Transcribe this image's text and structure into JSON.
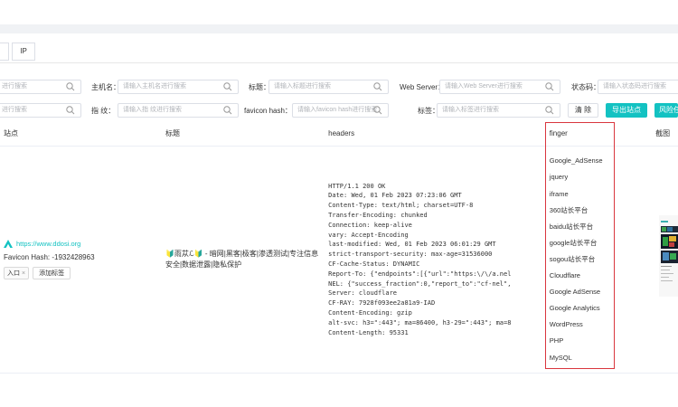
{
  "tabs": {
    "ip_label": "IP"
  },
  "filters": {
    "row1": [
      {
        "label": "",
        "placeholder": "进行搜索"
      },
      {
        "label": "主机名：",
        "placeholder": "请输入主机名进行搜索"
      },
      {
        "label": "标题：",
        "placeholder": "请输入标题进行搜索"
      },
      {
        "label": "Web Server：",
        "placeholder": "请输入Web Server进行搜索"
      },
      {
        "label": "状态码：",
        "placeholder": "请输入状态码进行搜索"
      }
    ],
    "row2": [
      {
        "label": "",
        "placeholder": "进行搜索"
      },
      {
        "label": "指 纹：",
        "placeholder": "请输入指 纹进行搜索"
      },
      {
        "label": "favicon hash：",
        "placeholder": "请输入favicon hash进行搜索"
      },
      {
        "label": "标签：",
        "placeholder": "请输入标签进行搜索"
      }
    ],
    "clear_label": "清 除",
    "export_label": "导出站点",
    "risk_label": "风险任"
  },
  "table": {
    "columns": {
      "site": "站点",
      "title": "标题",
      "headers": "headers",
      "finger": "finger",
      "screenshot": "截图"
    },
    "row": {
      "site_url": "https://www.ddosi.org",
      "favicon_hash": "Favicon Hash: -1932428963",
      "tag": "入口",
      "tag_remove": "×",
      "add_tag_label": "添加标签",
      "title": "🔰雨苁ℒ🔰 - 暗网|黑客|极客|渗透测试|专注信息安全|数据泄露|隐私保护",
      "headers": [
        "HTTP/1.1 200 OK",
        "Date: Wed, 01 Feb 2023 07:23:06 GMT",
        "Content-Type: text/html; charset=UTF-8",
        "Transfer-Encoding: chunked",
        "Connection: keep-alive",
        "vary: Accept-Encoding",
        "last-modified: Wed, 01 Feb 2023 06:01:29 GMT",
        "strict-transport-security: max-age=31536000",
        "CF-Cache-Status: DYNAMIC",
        "Report-To: {\"endpoints\":[{\"url\":\"https:\\/\\/a.nel",
        "NEL: {\"success_fraction\":0,\"report_to\":\"cf-nel\",",
        "Server: cloudflare",
        "CF-RAY: 7928f093ee2a81a9-IAD",
        "Content-Encoding: gzip",
        "alt-svc: h3=\":443\"; ma=86400, h3-29=\":443\"; ma=8",
        "Content-Length: 95331"
      ],
      "fingers": [
        "Google_AdSense",
        "jquery",
        "iframe",
        "360站长平台",
        "baidu站长平台",
        "google站长平台",
        "sogou站长平台",
        "Cloudflare",
        "Google AdSense",
        "Google Analytics",
        "WordPress",
        "PHP",
        "MySQL"
      ]
    }
  },
  "colors": {
    "accent": "#13c2c2",
    "highlight_box": "#d9363e"
  }
}
